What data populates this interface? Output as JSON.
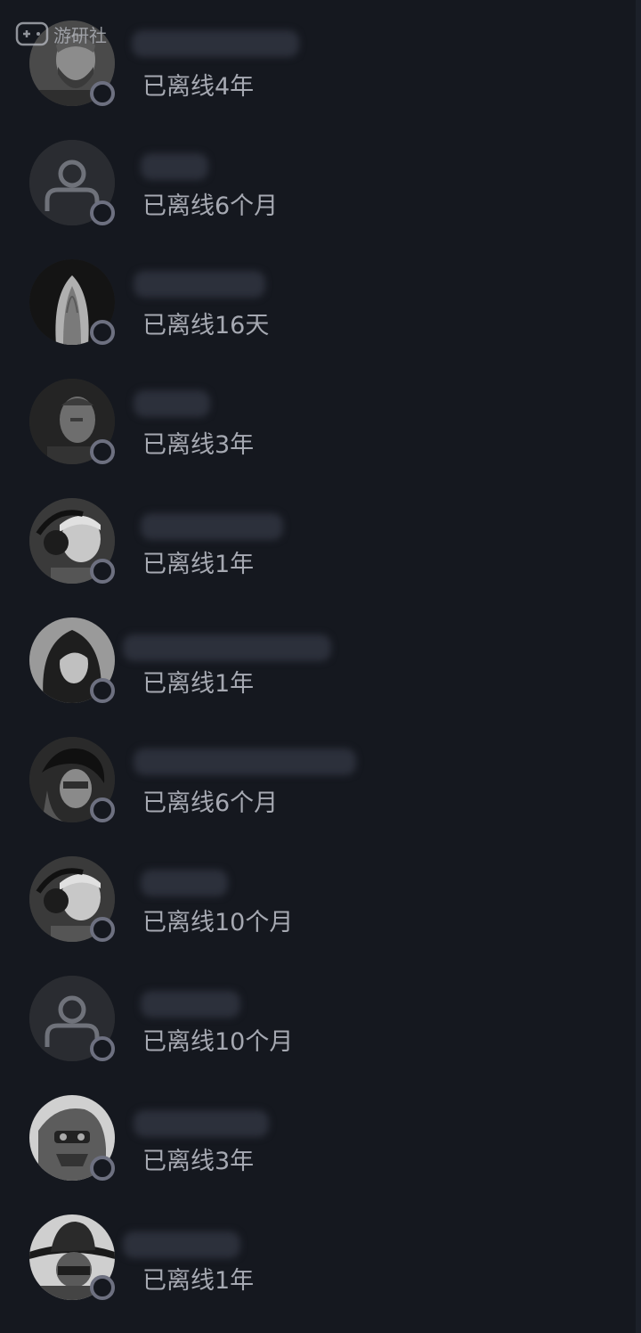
{
  "watermark": {
    "text": "游研社"
  },
  "friends": [
    {
      "status": "已离线4年",
      "avatar": "bearded-man"
    },
    {
      "status": "已离线6个月",
      "avatar": "default-user"
    },
    {
      "status": "已离线16天",
      "avatar": "long-haired"
    },
    {
      "status": "已离线3年",
      "avatar": "bald-man"
    },
    {
      "status": "已离线1年",
      "avatar": "headset-soldier"
    },
    {
      "status": "已离线1年",
      "avatar": "dark-haired-woman"
    },
    {
      "status": "已离线6个月",
      "avatar": "masked-woman"
    },
    {
      "status": "已离线10个月",
      "avatar": "headset-soldier"
    },
    {
      "status": "已离线10个月",
      "avatar": "default-user"
    },
    {
      "status": "已离线3年",
      "avatar": "robot-mech"
    },
    {
      "status": "已离线1年",
      "avatar": "cowboy-hat"
    }
  ],
  "colors": {
    "background": "#15181f",
    "status_text": "#a6a9b2",
    "status_ring": "#6d7080"
  }
}
